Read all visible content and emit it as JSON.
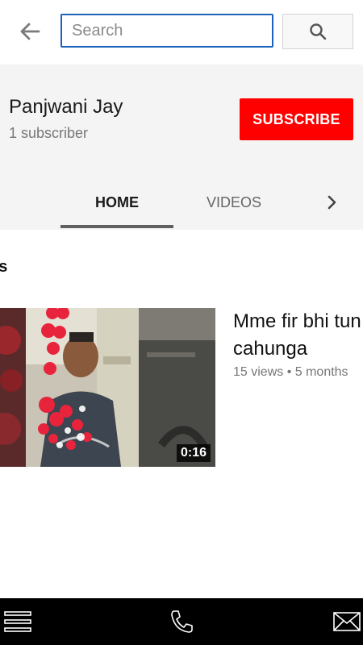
{
  "search": {
    "placeholder": "Search",
    "back_icon": "arrow-left-icon",
    "search_icon": "search-icon"
  },
  "channel": {
    "name": "Panjwani Jay",
    "subscribers": "1 subscriber",
    "subscribe_label": "SUBSCRIBE",
    "subscribe_color": "#ff0000"
  },
  "tabs": [
    {
      "label": "HOME",
      "active": true
    },
    {
      "label": "VIDEOS",
      "active": false
    }
  ],
  "tabs_next_icon": "chevron-right-icon",
  "section": {
    "title": "ds"
  },
  "video": {
    "title_line1": "Mme fir bhi tun",
    "title_line2": "cahunga",
    "meta": "15 views • 5 months",
    "duration": "0:16"
  },
  "bottom_bar": {
    "menu_icon": "menu-icon",
    "phone_icon": "phone-icon",
    "mail_icon": "mail-icon"
  },
  "colors": {
    "accent": "#1c62b9",
    "subscribe": "#ff0000",
    "tab_indicator": "#606060"
  }
}
